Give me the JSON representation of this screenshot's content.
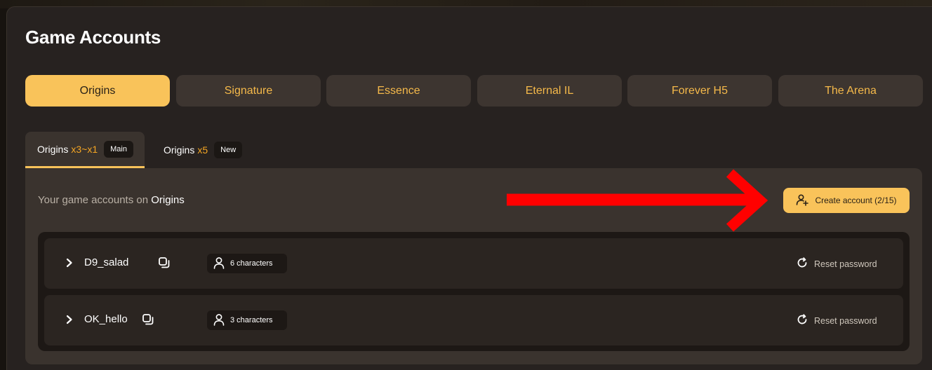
{
  "page": {
    "title": "Game Accounts"
  },
  "server_tabs": [
    {
      "label": "Origins",
      "active": true
    },
    {
      "label": "Signature",
      "active": false
    },
    {
      "label": "Essence",
      "active": false
    },
    {
      "label": "Eternal IL",
      "active": false
    },
    {
      "label": "Forever H5",
      "active": false
    },
    {
      "label": "The Arena",
      "active": false
    }
  ],
  "sub_tabs": [
    {
      "name": "Origins",
      "rate": "x3~x1",
      "badge": "Main",
      "active": true
    },
    {
      "name": "Origins",
      "rate": "x5",
      "badge": "New",
      "active": false
    }
  ],
  "content": {
    "label_prefix": "Your game accounts on",
    "server_name": "Origins",
    "create_button": {
      "label": "Create account (2/15)",
      "icon": "user-plus-icon"
    }
  },
  "accounts": [
    {
      "name": "D9_salad",
      "characters": "6 characters",
      "reset_label": "Reset password"
    },
    {
      "name": "OK_hello",
      "characters": "3 characters",
      "reset_label": "Reset password"
    }
  ],
  "colors": {
    "accent": "#f9c35a",
    "tab_text": "#f5b94a",
    "annotation_arrow": "#ff0000"
  }
}
